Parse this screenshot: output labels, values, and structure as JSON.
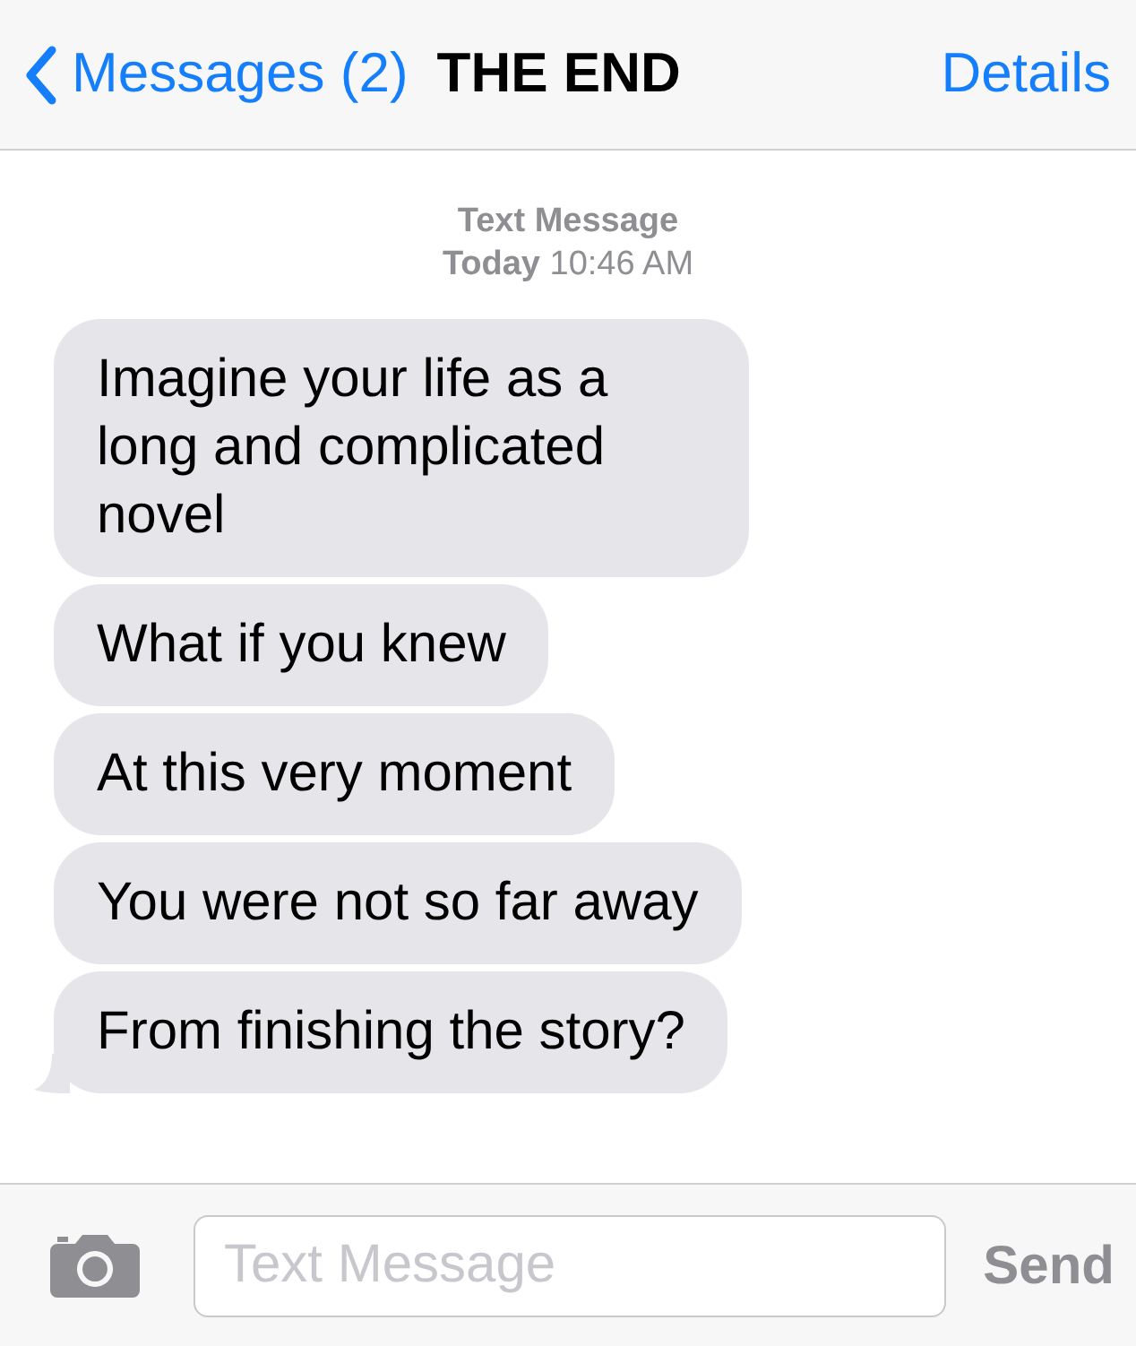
{
  "header": {
    "back_label": "Messages (2)",
    "title": "THE END",
    "action": "Details"
  },
  "timestamp": {
    "label": "Text Message",
    "time": "**Today** 10:46 AM"
  },
  "messages": [
    {
      "text": "Imagine your life as a long and complicated novel",
      "tail": false
    },
    {
      "text": "What if you knew",
      "tail": false
    },
    {
      "text": "At this very moment",
      "tail": false
    },
    {
      "text": "You were not so far away",
      "tail": false
    },
    {
      "text": "From finishing the story?",
      "tail": true
    }
  ],
  "composer": {
    "placeholder": "Text Message",
    "send": "Send"
  }
}
